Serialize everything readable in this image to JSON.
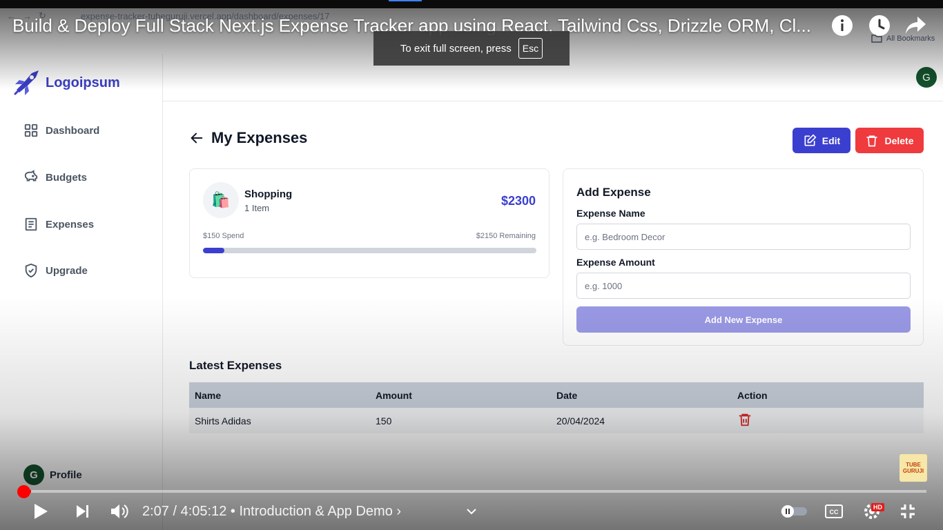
{
  "browser": {
    "url": "expense-tracker-tubeguruji.vercel.app/dashboard/expenses/17",
    "bookmarks_label": "All Bookmarks"
  },
  "video": {
    "title": "Build & Deploy Full Stack Next.js Expense Tracker app using React, Tailwind Css, Drizzle ORM, Cl...",
    "fullscreen_notice": "To exit full screen, press",
    "esc_key": "Esc",
    "current_time": "2:07",
    "duration": "4:05:12",
    "chapter": "Introduction & App Demo",
    "progress_fraction": 0.0086,
    "quality_badge": "HD",
    "watermark": [
      "TUBE",
      "GURUJI"
    ]
  },
  "sidebar": {
    "logo": "Logoipsum",
    "items": [
      {
        "label": "Dashboard",
        "icon": "grid-icon"
      },
      {
        "label": "Budgets",
        "icon": "piggy-bank-icon"
      },
      {
        "label": "Expenses",
        "icon": "receipt-icon"
      },
      {
        "label": "Upgrade",
        "icon": "shield-check-icon"
      }
    ],
    "profile_label": "Profile",
    "avatar_initial": "G"
  },
  "header": {
    "avatar_initial": "G"
  },
  "page": {
    "title": "My Expenses",
    "edit_label": "Edit",
    "delete_label": "Delete"
  },
  "budget": {
    "icon": "🛍️",
    "name": "Shopping",
    "items": "1 Item",
    "amount": "$2300",
    "spend": "$150 Spend",
    "remaining": "$2150 Remaining",
    "progress_fraction": 0.065
  },
  "add_expense": {
    "title": "Add Expense",
    "name_label": "Expense Name",
    "name_placeholder": "e.g. Bedroom Decor",
    "amount_label": "Expense Amount",
    "amount_placeholder": "e.g. 1000",
    "button_label": "Add New Expense"
  },
  "latest": {
    "title": "Latest Expenses",
    "columns": [
      "Name",
      "Amount",
      "Date",
      "Action"
    ],
    "rows": [
      {
        "name": "Shirts Adidas",
        "amount": "150",
        "date": "20/04/2024"
      }
    ]
  },
  "colors": {
    "primary": "#3b3fcf",
    "danger": "#ef3a3e",
    "progress_played": "#ff0000"
  }
}
